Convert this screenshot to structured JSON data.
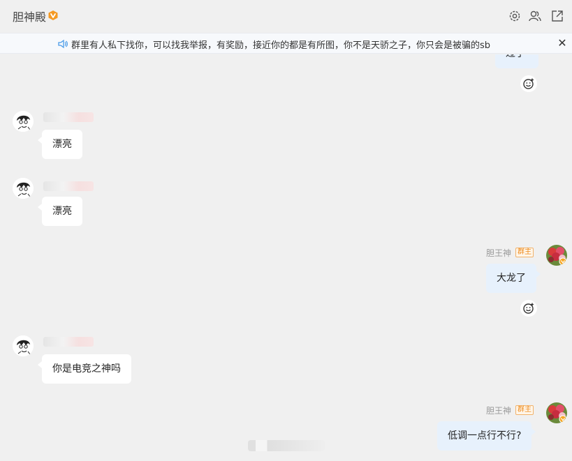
{
  "header": {
    "title": "胆神殿",
    "icons": [
      "vip-icon",
      "settings-icon",
      "members-icon",
      "popout-icon"
    ]
  },
  "notice": {
    "text": "群里有人私下找你，可以找我举报，有奖励，接近你的都是有所图，你不是天骄之子，你只会是被骗的sb",
    "close_glyph": "✕"
  },
  "messages": [
    {
      "side": "right",
      "text": "过了",
      "partial": true
    },
    {
      "side": "left",
      "sender": "",
      "text": "漂亮"
    },
    {
      "side": "left",
      "sender": "",
      "text": "漂亮"
    },
    {
      "side": "right",
      "sender": "胆王神",
      "tag": "群主",
      "text": "大龙了"
    },
    {
      "side": "left",
      "sender": "",
      "text": "你是电竞之神吗"
    },
    {
      "side": "right",
      "sender": "胆王神",
      "tag": "群主",
      "text": "低调一点行不行?"
    }
  ],
  "colors": {
    "background": "#f0f0f0",
    "own_bubble": "#e7f1fc",
    "other_bubble": "#ffffff",
    "owner_tag": "#ee8a1b",
    "accent": "#4a9be8"
  }
}
